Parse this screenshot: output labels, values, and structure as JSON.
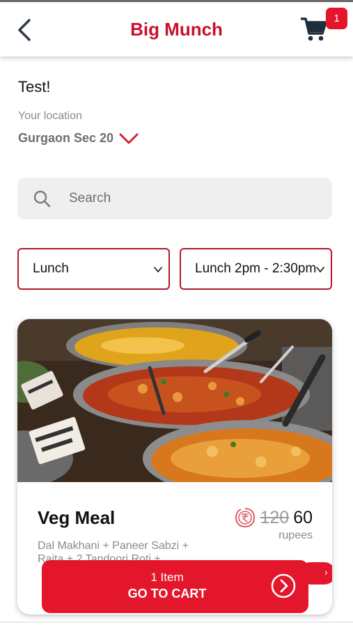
{
  "header": {
    "title": "Big Munch",
    "cart_count": "1",
    "brand_color": "#c8102e"
  },
  "greeting": "Test!",
  "location": {
    "label": "Your location",
    "value": "Gurgaon Sec 20"
  },
  "search": {
    "placeholder": "Search"
  },
  "filters": {
    "meal_type": "Lunch",
    "time_slot": "Lunch 2pm - 2:30pm"
  },
  "item": {
    "name": "Veg Meal",
    "description": "Dal Makhani + Paneer Sabzi + Raita + 2 Tandoori Roti + ...",
    "old_price": "120",
    "price": "60",
    "unit": "rupees"
  },
  "cart_bar": {
    "count_text": "1 Item",
    "label": "GO TO CART",
    "color": "#e3162b"
  }
}
